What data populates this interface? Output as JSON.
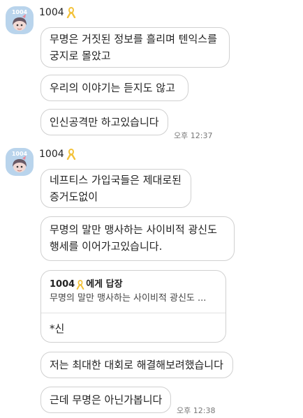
{
  "groups": [
    {
      "sender": "1004",
      "avatar_label": "1004",
      "messages": [
        {
          "lines": [
            "무명은 거짓된 정보를 흘리며 텐익스를",
            "궁지로 몰았고"
          ]
        },
        {
          "lines": [
            "우리의 이야기는 듣지도 않고"
          ]
        },
        {
          "lines": [
            "인신공격만 하고있습니다"
          ]
        }
      ],
      "time": "오후 12:37"
    },
    {
      "sender": "1004",
      "avatar_label": "1004",
      "messages": [
        {
          "lines": [
            "네프티스 가입국들은 제대로된",
            "증거도없이"
          ]
        },
        {
          "lines": [
            "무명의 말만 맹사하는 사이비적 광신도",
            "행세를 이어가고있습니다."
          ]
        }
      ],
      "reply": {
        "target": "1004",
        "suffix": "에게 답장",
        "quote": "무명의 말만 맹사하는 사이비적 광신도 ...",
        "text": "*신"
      },
      "after_messages": [
        {
          "lines": [
            "저는 최대한 대회로 해결해보려했습니다"
          ]
        },
        {
          "lines": [
            "근데 무명은 아닌가봅니다"
          ]
        }
      ],
      "time": "오후 12:38"
    }
  ],
  "icons": {
    "ribbon": "yellow-ribbon-icon",
    "avatar": "character-avatar-icon"
  },
  "colors": {
    "ribbon": "#f3c23a",
    "avatar_bg": "#b9d4ec",
    "bubble_border": "#d0d0d0"
  }
}
